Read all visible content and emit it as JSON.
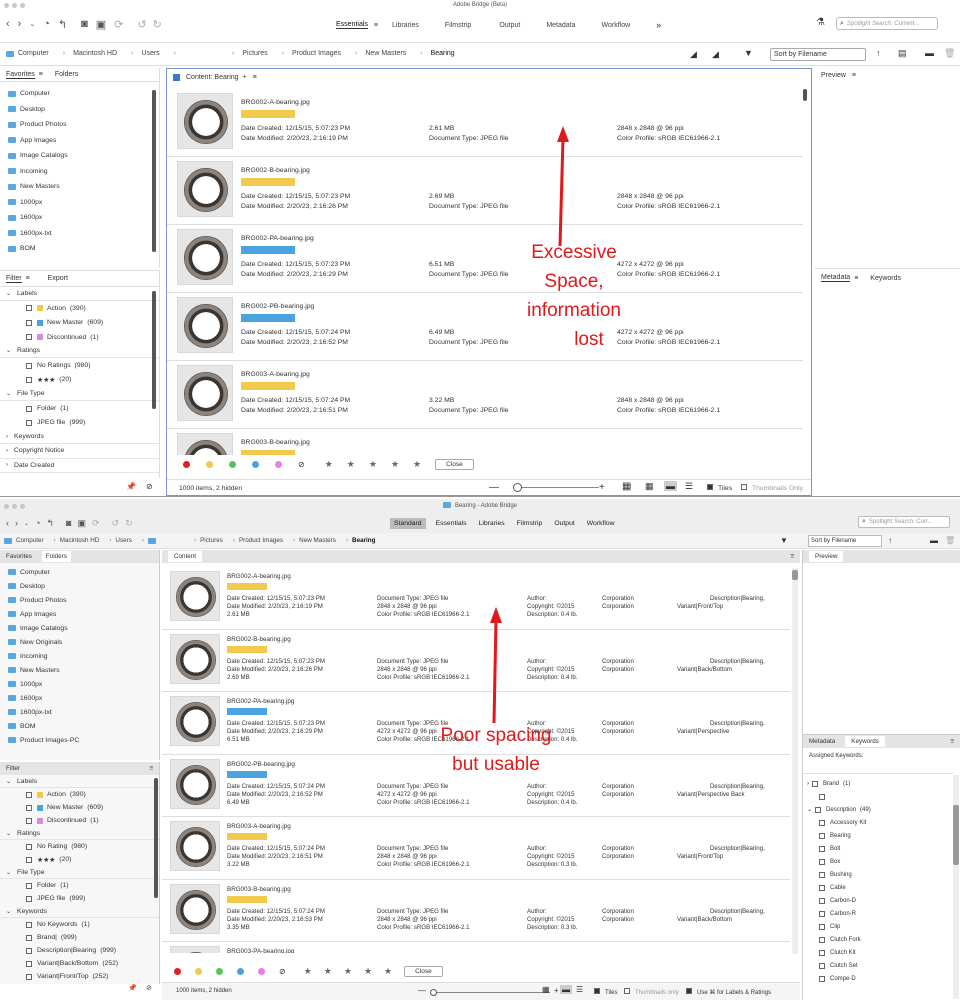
{
  "top": {
    "title": "Adobe Bridge (Beta)",
    "workspaces": [
      "Essentials",
      "Libraries",
      "Filmstrip",
      "Output",
      "Metadata",
      "Workflow"
    ],
    "more": "»",
    "search_placeholder": "Spotlight Search: Current...",
    "breadcrumb": [
      "Computer",
      "Macintosh HD",
      "Users",
      "Pictures",
      "Product Images",
      "New Masters",
      "Bearing"
    ],
    "sort": "Sort by Filename",
    "favorites_tab": "Favorites",
    "folders_tab": "Folders",
    "favorites": [
      "Computer",
      "Desktop",
      "Product Photos",
      "App Images",
      "Image Catalogs",
      "Incoming",
      "New Masters",
      "1000px",
      "1600px",
      "1600px-txt",
      "BOM"
    ],
    "filter_tab": "Filter",
    "export_tab": "Export",
    "filter": {
      "labels_head": "Labels",
      "labels": [
        {
          "name": "Action",
          "count": "(390)",
          "color": "#f2c94c"
        },
        {
          "name": "New Master",
          "count": "(609)",
          "color": "#4aa3df"
        },
        {
          "name": "Discontinued",
          "count": "(1)",
          "color": "#d98bd9"
        }
      ],
      "ratings_head": "Ratings",
      "ratings": [
        {
          "name": "No Ratings",
          "count": "(980)"
        },
        {
          "name": "★★★",
          "count": "(20)"
        }
      ],
      "filetype_head": "File Type",
      "filetypes": [
        {
          "name": "Folder",
          "count": "(1)"
        },
        {
          "name": "JPEG file",
          "count": "(999)"
        }
      ],
      "collapsed": [
        "Keywords",
        "Copyright Notice",
        "Date Created"
      ]
    },
    "content_tab": "Content: Bearing",
    "preview_tab": "Preview",
    "metadata_tab": "Metadata",
    "keywords_tab": "Keywords",
    "items": [
      {
        "name": "BRG002-A-bearing.jpg",
        "label": "#f2c94c",
        "created": "Date Created: 12/15/15, 5:07:23 PM",
        "modified": "Date Modified: 2/20/23, 2:16:19 PM",
        "size": "2.61 MB",
        "doctype": "Document Type: JPEG file",
        "dims": "2848 x 2848 @ 96 ppi",
        "profile": "Color Profile: sRGB IEC61966-2.1"
      },
      {
        "name": "BRG002-B-bearing.jpg",
        "label": "#f2c94c",
        "created": "Date Created: 12/15/15, 5:07:23 PM",
        "modified": "Date Modified: 2/20/23, 2:16:26 PM",
        "size": "2.69 MB",
        "doctype": "Document Type: JPEG file",
        "dims": "2848 x 2848 @ 96 ppi",
        "profile": "Color Profile: sRGB IEC61966-2.1"
      },
      {
        "name": "BRG002-PA-bearing.jpg",
        "label": "#4aa3df",
        "created": "Date Created: 12/15/15, 5:07:23 PM",
        "modified": "Date Modified: 2/20/23, 2:16:29 PM",
        "size": "6.51 MB",
        "doctype": "Document Type: JPEG file",
        "dims": "4272 x 4272 @ 96 ppi",
        "profile": "Color Profile: sRGB IEC61966-2.1"
      },
      {
        "name": "BRG002-PB-bearing.jpg",
        "label": "#4aa3df",
        "created": "Date Created: 12/15/15, 5:07:24 PM",
        "modified": "Date Modified: 2/20/23, 2:16:52 PM",
        "size": "6.49 MB",
        "doctype": "Document Type: JPEG file",
        "dims": "4272 x 4272 @ 96 ppi",
        "profile": "Color Profile: sRGB IEC61966-2.1"
      },
      {
        "name": "BRG003-A-bearing.jpg",
        "label": "#f2c94c",
        "created": "Date Created: 12/15/15, 5:07:24 PM",
        "modified": "Date Modified: 2/20/23, 2:16:51 PM",
        "size": "3.22 MB",
        "doctype": "Document Type: JPEG file",
        "dims": "2848 x 2848 @ 96 ppi",
        "profile": "Color Profile: sRGB IEC61966-2.1"
      },
      {
        "name": "BRG003-B-bearing.jpg",
        "label": "#f2c94c"
      }
    ],
    "close_btn": "Close",
    "status": "1000 items, 2 hidden",
    "tiles": "Tiles",
    "thumbs_only": "Thumbnails Only",
    "annotation": [
      "Excessive",
      "Space,",
      "information",
      "lost"
    ]
  },
  "bottom": {
    "title": "Bearing - Adobe Bridge",
    "workspaces": [
      "Standard",
      "Essentials",
      "Libraries",
      "Filmstrip",
      "Output",
      "Workflow"
    ],
    "search_placeholder": "Spotlight Search: Curr...",
    "breadcrumb": [
      "Computer",
      "Macintosh HD",
      "Users",
      "Pictures",
      "Product Images",
      "New Masters",
      "Bearing"
    ],
    "sort": "Sort by Filename",
    "favorites_tab": "Favorites",
    "folders_tab": "Folders",
    "favorites": [
      "Computer",
      "Desktop",
      "Product Photos",
      "App Images",
      "Image Catalogs",
      "New Originals",
      "Incoming",
      "New Masters",
      "1000px",
      "1600px",
      "1600px-txt",
      "BOM",
      "Product Images-PC"
    ],
    "filter_tab": "Filter",
    "filter": {
      "labels_head": "Labels",
      "labels": [
        {
          "name": "Action",
          "count": "(390)",
          "color": "#f2c94c"
        },
        {
          "name": "New Master",
          "count": "(609)",
          "color": "#4aa3df"
        },
        {
          "name": "Discontinued",
          "count": "(1)",
          "color": "#d98bd9"
        }
      ],
      "ratings_head": "Ratings",
      "ratings": [
        {
          "name": "No Rating",
          "count": "(980)"
        },
        {
          "name": "★★★",
          "count": "(20)"
        }
      ],
      "filetype_head": "File Type",
      "filetypes": [
        {
          "name": "Folder",
          "count": "(1)"
        },
        {
          "name": "JPEG file",
          "count": "(999)"
        }
      ],
      "keywords_head": "Keywords",
      "keywords": [
        {
          "name": "No Keywords",
          "count": "(1)"
        },
        {
          "name": "Brand|",
          "count": "(999)"
        },
        {
          "name": "Description|Bearing",
          "count": "(999)"
        },
        {
          "name": "Variant|Back/Bottom",
          "count": "(252)"
        },
        {
          "name": "Variant|Front/Top",
          "count": "(252)"
        }
      ]
    },
    "content_tab": "Content",
    "preview_tab": "Preview",
    "metadata_tab": "Metadata",
    "keywords_tab": "Keywords",
    "assigned": "Assigned Keywords:",
    "kw_tree": [
      {
        "name": "Brand",
        "count": "(1)",
        "level": 0,
        "open": false
      },
      {
        "name": "",
        "count": "",
        "level": 1
      },
      {
        "name": "Description",
        "count": "(49)",
        "level": 0,
        "open": true
      },
      {
        "name": "Accessory Kit",
        "level": 1
      },
      {
        "name": "Bearing",
        "level": 1
      },
      {
        "name": "Bolt",
        "level": 1
      },
      {
        "name": "Box",
        "level": 1
      },
      {
        "name": "Bushing",
        "level": 1
      },
      {
        "name": "Cable",
        "level": 1
      },
      {
        "name": "Carbon-D",
        "level": 1
      },
      {
        "name": "Carbon-R",
        "level": 1
      },
      {
        "name": "Clip",
        "level": 1
      },
      {
        "name": "Clutch Fork",
        "level": 1
      },
      {
        "name": "Clutch Kit",
        "level": 1
      },
      {
        "name": "Clutch Set",
        "level": 1
      },
      {
        "name": "Compe-D",
        "level": 1
      }
    ],
    "items": [
      {
        "name": "BRG002-A-bearing.jpg",
        "label": "#f2c94c",
        "created": "Date Created: 12/15/15, 5:07:23 PM",
        "modified": "Date Modified: 2/20/23, 2:16:19 PM",
        "size": "2.61 MB",
        "doctype": "Document Type: JPEG file",
        "dims": "2848 x 2848 @ 96 ppi",
        "profile": "Color Profile: sRGB IEC61966-2.1",
        "author": "Author:",
        "copyright": "Copyright: ©2015",
        "desc": "Description: 0.4 lb.",
        "corp1": "Corporation",
        "corp2": "Corporation",
        "kw1": "Description|Bearing,",
        "kw2": "Variant|Front/Top"
      },
      {
        "name": "BRG002-B-bearing.jpg",
        "label": "#f2c94c",
        "created": "Date Created: 12/15/15, 5:07:23 PM",
        "modified": "Date Modified: 2/20/23, 2:16:26 PM",
        "size": "2.69 MB",
        "doctype": "Document Type: JPEG file",
        "dims": "2848 x 2848 @ 96 ppi",
        "profile": "Color Profile: sRGB IEC61966-2.1",
        "author": "Author:",
        "copyright": "Copyright: ©2015",
        "desc": "Description: 0.4 lb.",
        "corp1": "Corporation",
        "corp2": "Corporation",
        "kw1": "Description|Bearing,",
        "kw2": "Variant|Back/Bottom"
      },
      {
        "name": "BRG002-PA-bearing.jpg",
        "label": "#4aa3df",
        "created": "Date Created: 12/15/15, 5:07:23 PM",
        "modified": "Date Modified: 2/20/23, 2:16:29 PM",
        "size": "6.51 MB",
        "doctype": "Document Type: JPEG file",
        "dims": "4272 x 4272 @ 96 ppi",
        "profile": "Color Profile: sRGB IEC61966-2.1",
        "author": "Author:",
        "copyright": "Copyright: ©2015",
        "desc": "Description: 0.4 lb.",
        "corp1": "Corporation",
        "corp2": "Corporation",
        "kw1": "Description|Bearing,",
        "kw2": "Variant|Perspective"
      },
      {
        "name": "BRG002-PB-bearing.jpg",
        "label": "#4aa3df",
        "created": "Date Created: 12/15/15, 5:07:24 PM",
        "modified": "Date Modified: 2/20/23, 2:16:52 PM",
        "size": "6.49 MB",
        "doctype": "Document Type: JPEG file",
        "dims": "4272 x 4272 @ 96 ppi",
        "profile": "Color Profile: sRGB IEC61966-2.1",
        "author": "Author:",
        "copyright": "Copyright: ©2015",
        "desc": "Description: 0.4 lb.",
        "corp1": "Corporation",
        "corp2": "Corporation",
        "kw1": "Description|Bearing,",
        "kw2": "Variant|Perspective Back"
      },
      {
        "name": "BRG003-A-bearing.jpg",
        "label": "#f2c94c",
        "created": "Date Created: 12/15/15, 5:07:24 PM",
        "modified": "Date Modified: 2/20/23, 2:16:51 PM",
        "size": "3.22 MB",
        "doctype": "Document Type: JPEG file",
        "dims": "2848 x 2848 @ 96 ppi",
        "profile": "Color Profile: sRGB IEC61966-2.1",
        "author": "Author:",
        "copyright": "Copyright: ©2015",
        "desc": "Description: 0.3 lb.",
        "corp1": "Corporation",
        "corp2": "Corporation",
        "kw1": "Description|Bearing,",
        "kw2": "Variant|Front/Top"
      },
      {
        "name": "BRG003-B-bearing.jpg",
        "label": "#f2c94c",
        "created": "Date Created: 12/15/15, 5:07:24 PM",
        "modified": "Date Modified: 2/20/23, 2:16:53 PM",
        "size": "3.35 MB",
        "doctype": "Document Type: JPEG file",
        "dims": "2848 x 2848 @ 96 ppi",
        "profile": "Color Profile: sRGB IEC61966-2.1",
        "author": "Author:",
        "copyright": "Copyright: ©2015",
        "desc": "Description: 0.3 lb.",
        "corp1": "Corporation",
        "corp2": "Corporation",
        "kw1": "Description|Bearing,",
        "kw2": "Variant|Back/Bottom"
      },
      {
        "name": "BRG003-PA-bearing.jpg",
        "label": ""
      }
    ],
    "close_btn": "Close",
    "status": "1000 items, 2 hidden",
    "tiles": "Tiles",
    "thumbs_only": "Thumbnails only",
    "use_cmd": "Use ⌘ for Labels & Ratings",
    "annotation": [
      "Poor spacing",
      "but usable"
    ]
  },
  "label_colors": [
    "#e02020",
    "#f2c94c",
    "#5cc05c",
    "#4aa3df",
    "#e87ee8"
  ]
}
